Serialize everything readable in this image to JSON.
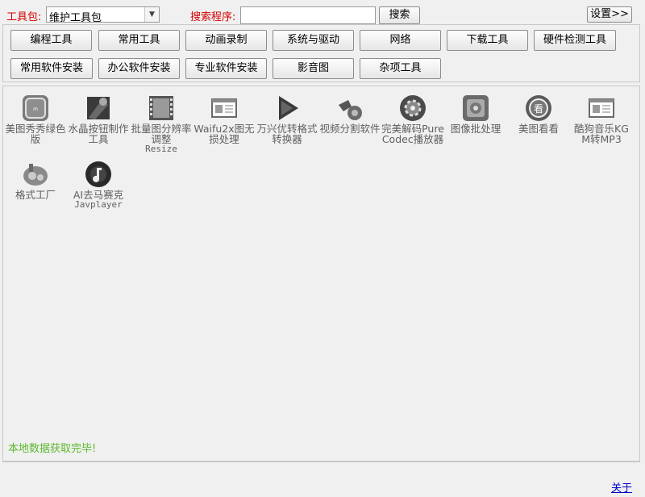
{
  "toolbar": {
    "toolkit_label": "工具包:",
    "toolkit_value": "维护工具包",
    "search_label": "搜索程序:",
    "search_value": "",
    "search_button": "搜索",
    "settings_button": "设置>>"
  },
  "categories": [
    "编程工具",
    "常用工具",
    "动画录制",
    "系统与驱动",
    "网络",
    "下载工具",
    "硬件检测工具",
    "常用软件安装",
    "办公软件安装",
    "专业软件安装",
    "影音图",
    "杂项工具"
  ],
  "apps": [
    {
      "name": "美图秀秀绿色版",
      "icon": "meitu-xiuxiu-icon"
    },
    {
      "name": "水晶按钮制作工具",
      "icon": "crystal-button-icon"
    },
    {
      "name": "批量图分辨率调整",
      "sub": "Resize",
      "icon": "film-resize-icon"
    },
    {
      "name": "Waifu2x图无损处理",
      "icon": "window-icon"
    },
    {
      "name": "万兴优转格式转换器",
      "icon": "play-triangle-icon"
    },
    {
      "name": "视频分割软件",
      "icon": "video-split-icon"
    },
    {
      "name": "完美解码PureCodec播放器",
      "icon": "gear-player-icon"
    },
    {
      "name": "图像批处理",
      "icon": "image-batch-icon"
    },
    {
      "name": "美图看看",
      "icon": "meitu-kankan-icon"
    },
    {
      "name": "酷狗音乐KGM转MP3",
      "icon": "window-icon"
    },
    {
      "name": "格式工厂",
      "icon": "format-factory-icon"
    },
    {
      "name": "AI去马赛克",
      "sub": "Javplayer",
      "icon": "music-disc-icon"
    }
  ],
  "status_text": "本地数据获取完毕!",
  "about_link": "关于"
}
